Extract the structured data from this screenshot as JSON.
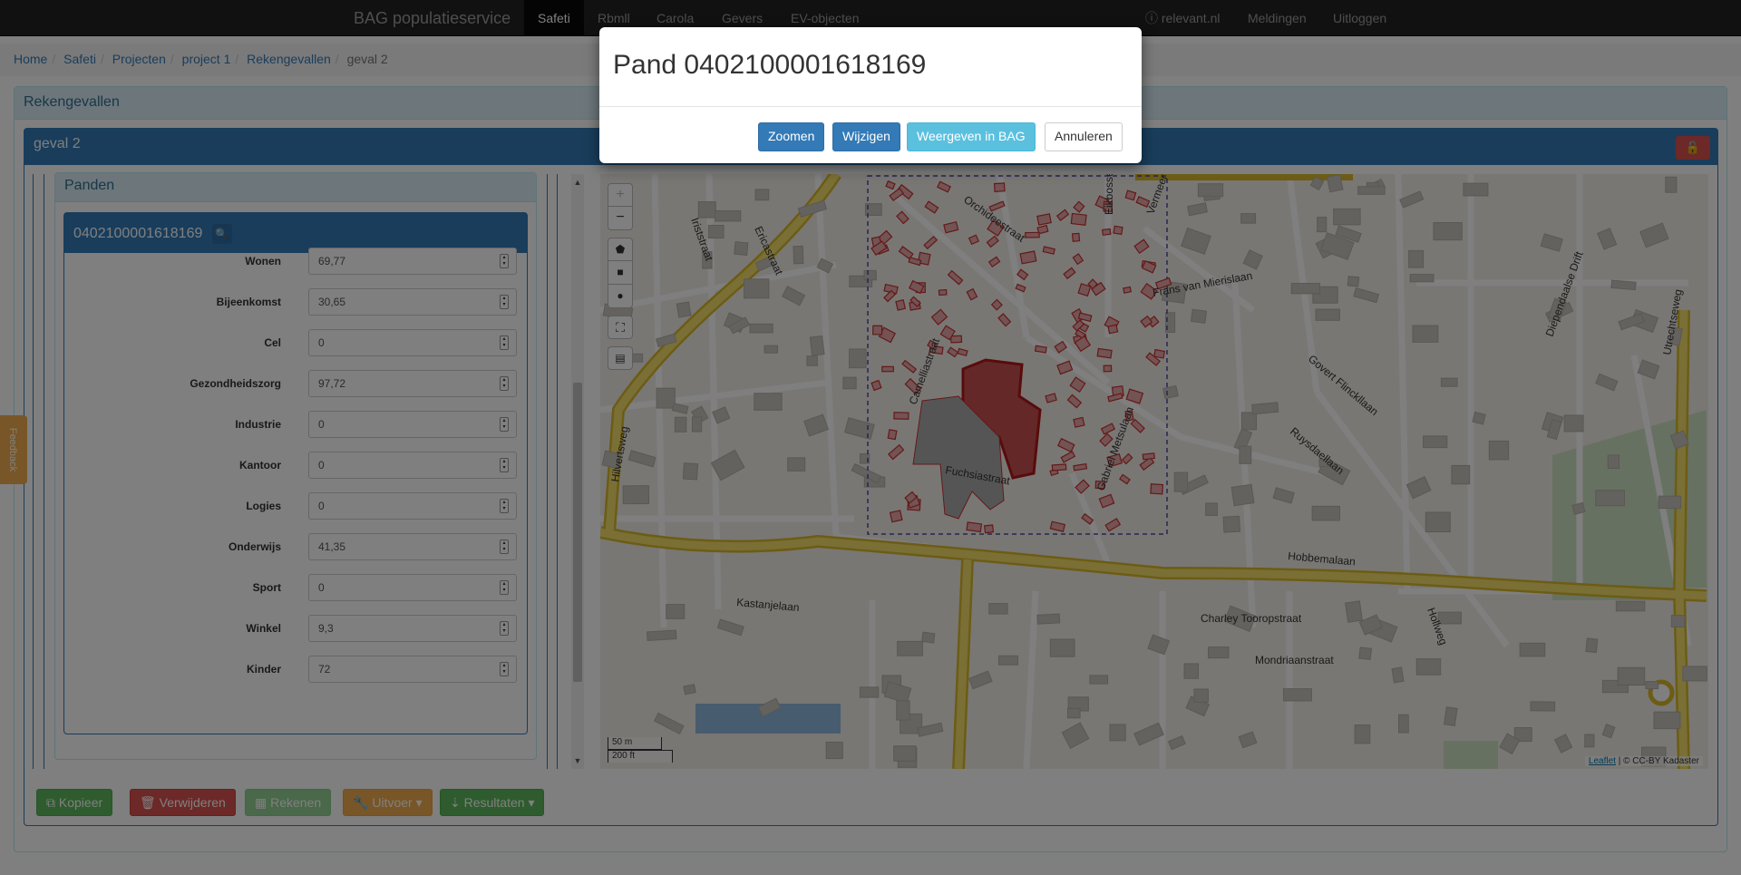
{
  "navbar": {
    "brand": "BAG populatieservice",
    "items": [
      "Safeti",
      "Rbmll",
      "Carola",
      "Gevers",
      "EV-objecten"
    ],
    "right_items": [
      "relevant.nl",
      "Meldingen",
      "Uitloggen"
    ]
  },
  "breadcrumb": {
    "links": [
      "Home",
      "Safeti",
      "Projecten",
      "project 1",
      "Rekengevallen"
    ],
    "current": "geval 2"
  },
  "outer_panel": {
    "title": "Rekengevallen"
  },
  "case_panel": {
    "title": "geval 2"
  },
  "panden_panel": {
    "title": "Panden",
    "pand_id": "0402100001618169",
    "fields": [
      {
        "label": "Wonen",
        "value": "69,77"
      },
      {
        "label": "Bijeenkomst",
        "value": "30,65"
      },
      {
        "label": "Cel",
        "value": "0"
      },
      {
        "label": "Gezondheidszorg",
        "value": "97,72"
      },
      {
        "label": "Industrie",
        "value": "0"
      },
      {
        "label": "Kantoor",
        "value": "0"
      },
      {
        "label": "Logies",
        "value": "0"
      },
      {
        "label": "Onderwijs",
        "value": "41,35"
      },
      {
        "label": "Sport",
        "value": "0"
      },
      {
        "label": "Winkel",
        "value": "9,3"
      },
      {
        "label": "Kinder",
        "value": "72"
      }
    ]
  },
  "map": {
    "street_labels": [
      "Orchideestraat",
      "Eikbosse",
      "Vermeer",
      "Frans van Mierislaan",
      "Iriststraat",
      "Ericastraat",
      "Camelliastraat",
      "Govert Flinckllaan",
      "Ruysdaellaan",
      "Fuchsiastraat",
      "Gabriel Metsulaan",
      "Hilvertsweg",
      "Hobbemalaan",
      "Kastanjelaan",
      "Charley Tooropstraat",
      "Mondriaanstraat",
      "Hollweg",
      "Diependaalse Drift",
      "Utrechtseweg"
    ],
    "scale_m": "50 m",
    "scale_ft": "200 ft",
    "attribution_link": "Leaflet",
    "attribution_text": " | © CC-BY Kadaster",
    "controls": [
      "+",
      "−"
    ]
  },
  "feedback": "Feedback",
  "bottom_buttons": {
    "kopieer": "Kopieer",
    "verwijderen": "Verwijderen",
    "rekenen": "Rekenen",
    "uitvoer": "Uitvoer",
    "resultaten": "Resultaten"
  },
  "modal": {
    "title": "Pand 0402100001618169",
    "buttons": {
      "zoomen": "Zoomen",
      "wijzigen": "Wijzigen",
      "weergeven": "Weergeven in BAG",
      "annuleren": "Annuleren"
    }
  },
  "colors": {
    "navbar_bg": "#222222",
    "primary": "#337ab7",
    "info": "#5bc0de",
    "success": "#5cb85c",
    "danger": "#d9534f",
    "warning": "#f0ad4e",
    "selected_building": "#c83232"
  }
}
